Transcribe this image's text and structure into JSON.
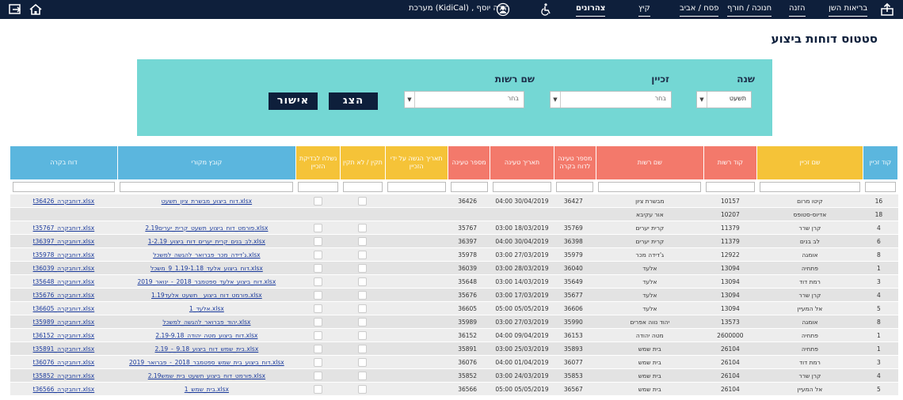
{
  "nav": {
    "items": [
      "בריאות השן",
      "הזנה",
      "חנוכה / חורף",
      "פסח / אביב",
      "קיץ",
      "צהרונים"
    ],
    "active": "צהרונים",
    "user_text": "מערכת (KidiCal) , הילה יוסף"
  },
  "page_title": "סטטוס דוחות ביצוע",
  "filters": {
    "year_label": "שנה",
    "year_value": "תשעט",
    "franchisee_label": "זכיין",
    "franchisee_value": "בחר",
    "authority_label": "שם רשות",
    "authority_value": "בחר",
    "show_button": "הצג",
    "confirm_button": "אישור"
  },
  "table": {
    "headers": [
      "קוד זכיין",
      "שם זכיין",
      "קוד רשות",
      "שם רשות",
      "מספר טעינה לדוח בקרה",
      "תאריך טעינה",
      "מספר טעינה",
      "תאריך הגשה על ידי הזכיין",
      "תקין / לא תקין",
      "נשלח לבדיקת הזכיין",
      "קובץ מקורי",
      "דוח בקרה"
    ],
    "rows": [
      [
        "16",
        "קיטו מרום",
        "10157",
        "מבשרת ציון",
        "36427",
        "30/04/2019 04:00",
        "36426",
        "",
        "",
        "",
        "דוח_ביצוע_מבשרת_ציון_תשעט.xlsx",
        "t36426_דוחבקרה.xlsx"
      ],
      [
        "18",
        "אדיוס-סטופס",
        "10207",
        "אור עקיבא",
        "",
        "",
        "",
        "",
        "",
        "",
        "",
        ""
      ],
      [
        "4",
        "קרן שרר",
        "11379",
        "קרית יערים",
        "35769",
        "18/03/2019 03:00",
        "35767",
        "",
        "",
        "",
        "פורמט_דוח_ביצוע_תשעט_קרית_יערים2.19.xlsx",
        "t35767_דוחבקרה.xlsx"
      ],
      [
        "6",
        "לב בנים",
        "11379",
        "קרית יערים",
        "36398",
        "30/04/2019 04:00",
        "36397",
        "",
        "",
        "",
        "לב_בנים_קרית_יערים_דוח_ביצוע_1-2.19.xlsx",
        "t36397_דוחבקרה.xlsx"
      ],
      [
        "8",
        "אומגה",
        "12922",
        "ג'דידה מכר",
        "35979",
        "27/03/2019 03:00",
        "35978",
        "",
        "",
        "",
        "ג'דידה_מכר_פברואר_להגשה_למשכל.xlsx",
        "t35978_דוחבקרה.xlsx"
      ],
      [
        "1",
        "פתחיה",
        "13094",
        "אלעד",
        "36040",
        "28/03/2019 03:00",
        "36039",
        "",
        "",
        "",
        "דוח_ביצוע_אלעד_1.19-1.18_9_משכל.xlsx",
        "t36039_דוחבקרה.xlsx"
      ],
      [
        "3",
        "רמת דוד",
        "13094",
        "אלעד",
        "35649",
        "14/03/2019 03:00",
        "35648",
        "",
        "",
        "",
        "דוח_ביצוע_אלעד_ספטמבר_2018_-_ינואר_2019.xlsx",
        "t35648_דוחבקרה.xlsx"
      ],
      [
        "4",
        "קרן שרר",
        "13094",
        "אלעד",
        "35677",
        "17/03/2019 03:00",
        "35676",
        "",
        "",
        "",
        "פורמט_דוח_ביצוע__תשעט_אלעד1.19.xlsx",
        "t35676_דוחבקרה.xlsx"
      ],
      [
        "5",
        "אל המעיין",
        "13094",
        "אלעד",
        "36606",
        "05/05/2019 05:00",
        "36605",
        "",
        "",
        "",
        "אלעד_1.xlsx",
        "t36605_דוחבקרה.xlsx"
      ],
      [
        "8",
        "אומגה",
        "13573",
        "יהוד נווה אפרים",
        "35990",
        "27/03/2019 03:00",
        "35989",
        "",
        "",
        "",
        "יהוד_פברואר_להגשה_למשכל.xlsx",
        "t35989_דוחבקרה.xlsx"
      ],
      [
        "1",
        "פתחיה",
        "2600000",
        "מטה יהודה",
        "36153",
        "09/04/2019 04:00",
        "36152",
        "",
        "",
        "",
        "דוח_ביצוע_מטה_יהודה_2.19-9.18.xlsx",
        "t36152_דוחבקרה.xlsx"
      ],
      [
        "1",
        "פתחיה",
        "26104",
        "בית שמש",
        "35893",
        "25/03/2019 03:00",
        "35891",
        "",
        "",
        "",
        "בית_שמש_דוח_ביצוע_9.18_-_2.19.xlsx",
        "t35891_דוחבקרה.xlsx"
      ],
      [
        "3",
        "רמת דוד",
        "26104",
        "בית שמש",
        "36077",
        "01/04/2019 04:00",
        "36076",
        "",
        "",
        "",
        "דוח_ביצוע_בית_שמש_ספטמבר_2018_-_פברואר_2019.xlsx",
        "t36076_דוחבקרה.xlsx"
      ],
      [
        "4",
        "קרן שרר",
        "26104",
        "בית שמש",
        "35853",
        "24/03/2019 03:00",
        "35852",
        "",
        "",
        "",
        "פורמט_דוח_ביצוע_תשעט_בית_שמש2.19.xlsx",
        "t35852_דוחבקרה.xlsx"
      ],
      [
        "5",
        "אל המעיין",
        "26104",
        "בית שמש",
        "36567",
        "05/05/2019 05:00",
        "36566",
        "",
        "",
        "",
        "בית_שמש_1.xlsx",
        "t36566_דוחבקרה.xlsx"
      ]
    ]
  },
  "colors": {
    "navy": "#0e1f3b",
    "teal": "#74d7d4",
    "blue_header": "#5bb6de",
    "yellow_header": "#f5c338",
    "red_header": "#f3796b"
  }
}
